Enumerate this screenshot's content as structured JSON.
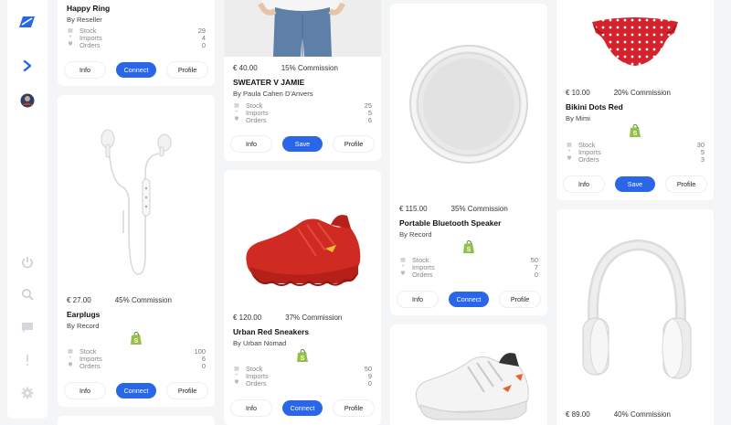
{
  "icons": {
    "logo": "logo-icon",
    "nav": "chevron-right-icon",
    "avatar": "avatar",
    "power": "power-icon",
    "search": "search-icon",
    "chat": "chat-icon",
    "info": "info-icon",
    "settings": "gear-icon",
    "shopify": "shopify-icon"
  },
  "colors": {
    "accent": "#2a66e8",
    "shopify": "#95bf47"
  },
  "stat_labels": {
    "stock": "Stock",
    "imports": "Imports",
    "orders": "Orders"
  },
  "buttons": {
    "info": "Info",
    "connect": "Connect",
    "save": "Save",
    "profile": "Profile"
  },
  "cards": {
    "happy_ring": {
      "title": "Happy Ring",
      "by": "By Reseller",
      "stock": "29",
      "imports": "4",
      "orders": "0"
    },
    "earplugs": {
      "price": "€ 27.00",
      "commission": "45% Commission",
      "title": "Earplugs",
      "by": "By Record",
      "stock": "100",
      "imports": "6",
      "orders": "0"
    },
    "sweater": {
      "price": "€ 40.00",
      "commission": "15% Commission",
      "title": "SWEATER V JAMIE",
      "by": "By Paula Cahen D'Anvers",
      "stock": "25",
      "imports": "5",
      "orders": "6"
    },
    "sneakers": {
      "price": "€ 120.00",
      "commission": "37% Commission",
      "title": "Urban Red Sneakers",
      "by": "By Urban Nomad",
      "stock": "50",
      "imports": "9",
      "orders": "0"
    },
    "speaker": {
      "price": "€ 115.00",
      "commission": "35% Commission",
      "title": "Portable Bluetooth Speaker",
      "by": "By Record",
      "stock": "50",
      "imports": "7",
      "orders": "0"
    },
    "bikini": {
      "price": "€ 10.00",
      "commission": "20% Commission",
      "title": "Bikini Dots Red",
      "by": "By Mimi",
      "stock": "30",
      "imports": "5",
      "orders": "3"
    },
    "headphones": {
      "price": "€ 89.00",
      "commission": "40% Commission"
    }
  }
}
